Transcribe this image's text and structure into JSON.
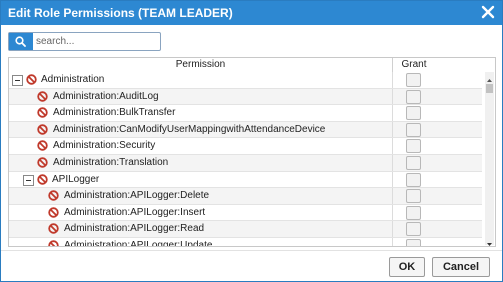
{
  "dialog": {
    "title": "Edit Role Permissions (TEAM LEADER)"
  },
  "search": {
    "placeholder": "search...",
    "value": ""
  },
  "grid": {
    "columns": {
      "permission": "Permission",
      "grant": "Grant"
    },
    "rows": [
      {
        "label": "Administration",
        "level": 0,
        "expandable": true,
        "granted": false
      },
      {
        "label": "Administration:AuditLog",
        "level": 1,
        "expandable": false,
        "granted": false
      },
      {
        "label": "Administration:BulkTransfer",
        "level": 1,
        "expandable": false,
        "granted": false
      },
      {
        "label": "Administration:CanModifyUserMappingwithAttendanceDevice",
        "level": 1,
        "expandable": false,
        "granted": false
      },
      {
        "label": "Administration:Security",
        "level": 1,
        "expandable": false,
        "granted": false
      },
      {
        "label": "Administration:Translation",
        "level": 1,
        "expandable": false,
        "granted": false
      },
      {
        "label": "APILogger",
        "level": 1,
        "expandable": true,
        "granted": false
      },
      {
        "label": "Administration:APILogger:Delete",
        "level": 2,
        "expandable": false,
        "granted": false
      },
      {
        "label": "Administration:APILogger:Insert",
        "level": 2,
        "expandable": false,
        "granted": false
      },
      {
        "label": "Administration:APILogger:Read",
        "level": 2,
        "expandable": false,
        "granted": false
      },
      {
        "label": "Administration:APILogger:Update",
        "level": 2,
        "expandable": false,
        "granted": false
      }
    ]
  },
  "buttons": {
    "ok": "OK",
    "cancel": "Cancel"
  },
  "colors": {
    "accent": "#2d88d2",
    "deny_icon": "#c0392b"
  },
  "icons": {
    "close": "close-icon",
    "search": "search-icon",
    "deny": "deny-icon",
    "collapse": "collapse-toggle-icon"
  }
}
